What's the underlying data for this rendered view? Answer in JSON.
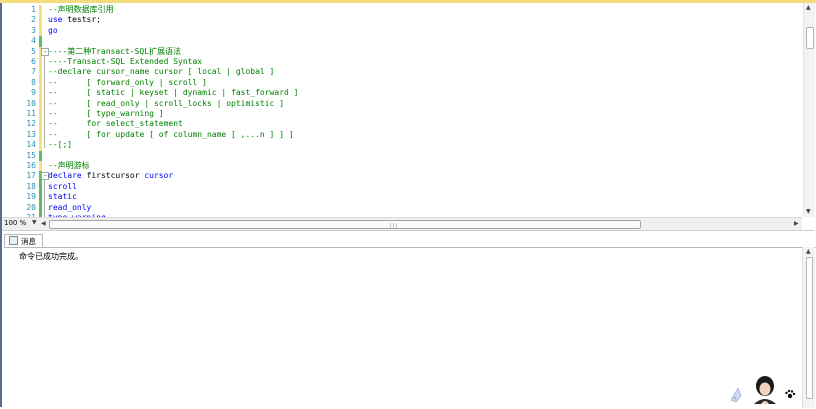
{
  "editor": {
    "lines": [
      {
        "n": "1",
        "segs": [
          {
            "t": "--声明数据库引用",
            "c": "c"
          }
        ]
      },
      {
        "n": "2",
        "segs": [
          {
            "t": "use ",
            "c": "k"
          },
          {
            "t": "testsr;",
            "c": "p"
          }
        ]
      },
      {
        "n": "3",
        "segs": [
          {
            "t": "go",
            "c": "k"
          }
        ]
      },
      {
        "n": "4",
        "segs": []
      },
      {
        "n": "5",
        "segs": [
          {
            "t": "----第二种Transact-SQL扩展语法",
            "c": "c"
          }
        ]
      },
      {
        "n": "6",
        "segs": [
          {
            "t": "----Transact-SQL Extended Syntax",
            "c": "c"
          }
        ]
      },
      {
        "n": "7",
        "segs": [
          {
            "t": "--declare cursor_name cursor [ local | global ]",
            "c": "c"
          }
        ]
      },
      {
        "n": "8",
        "segs": [
          {
            "t": "--      [ forward_only | scroll ]",
            "c": "c"
          }
        ]
      },
      {
        "n": "9",
        "segs": [
          {
            "t": "--      [ static | keyset | dynamic | fast_forward ]",
            "c": "c"
          }
        ]
      },
      {
        "n": "10",
        "segs": [
          {
            "t": "--      [ read_only | scroll_locks | optimistic ]",
            "c": "c"
          }
        ]
      },
      {
        "n": "11",
        "segs": [
          {
            "t": "--      [ type_warning ]",
            "c": "c"
          }
        ]
      },
      {
        "n": "12",
        "segs": [
          {
            "t": "--      for select_statement",
            "c": "c"
          }
        ]
      },
      {
        "n": "13",
        "segs": [
          {
            "t": "--      [ for update [ of column_name [ ,...n ] ] ]",
            "c": "c"
          }
        ]
      },
      {
        "n": "14",
        "segs": [
          {
            "t": "--[;]",
            "c": "c"
          }
        ]
      },
      {
        "n": "15",
        "segs": []
      },
      {
        "n": "16",
        "segs": [
          {
            "t": "--声明游标",
            "c": "c"
          }
        ]
      },
      {
        "n": "17",
        "segs": [
          {
            "t": "declare ",
            "c": "k"
          },
          {
            "t": "firstcursor ",
            "c": "p"
          },
          {
            "t": "cursor",
            "c": "k"
          }
        ]
      },
      {
        "n": "18",
        "segs": [
          {
            "t": "scroll",
            "c": "k"
          }
        ]
      },
      {
        "n": "19",
        "segs": [
          {
            "t": "static",
            "c": "k"
          }
        ]
      },
      {
        "n": "20",
        "segs": [
          {
            "t": "read_only",
            "c": "k"
          }
        ]
      },
      {
        "n": "21",
        "segs": [
          {
            "t": "type_warning",
            "c": "k"
          }
        ]
      }
    ]
  },
  "statusbar": {
    "zoom": "100 %"
  },
  "results": {
    "tab_label": "消息",
    "message": "命令已成功完成。"
  }
}
